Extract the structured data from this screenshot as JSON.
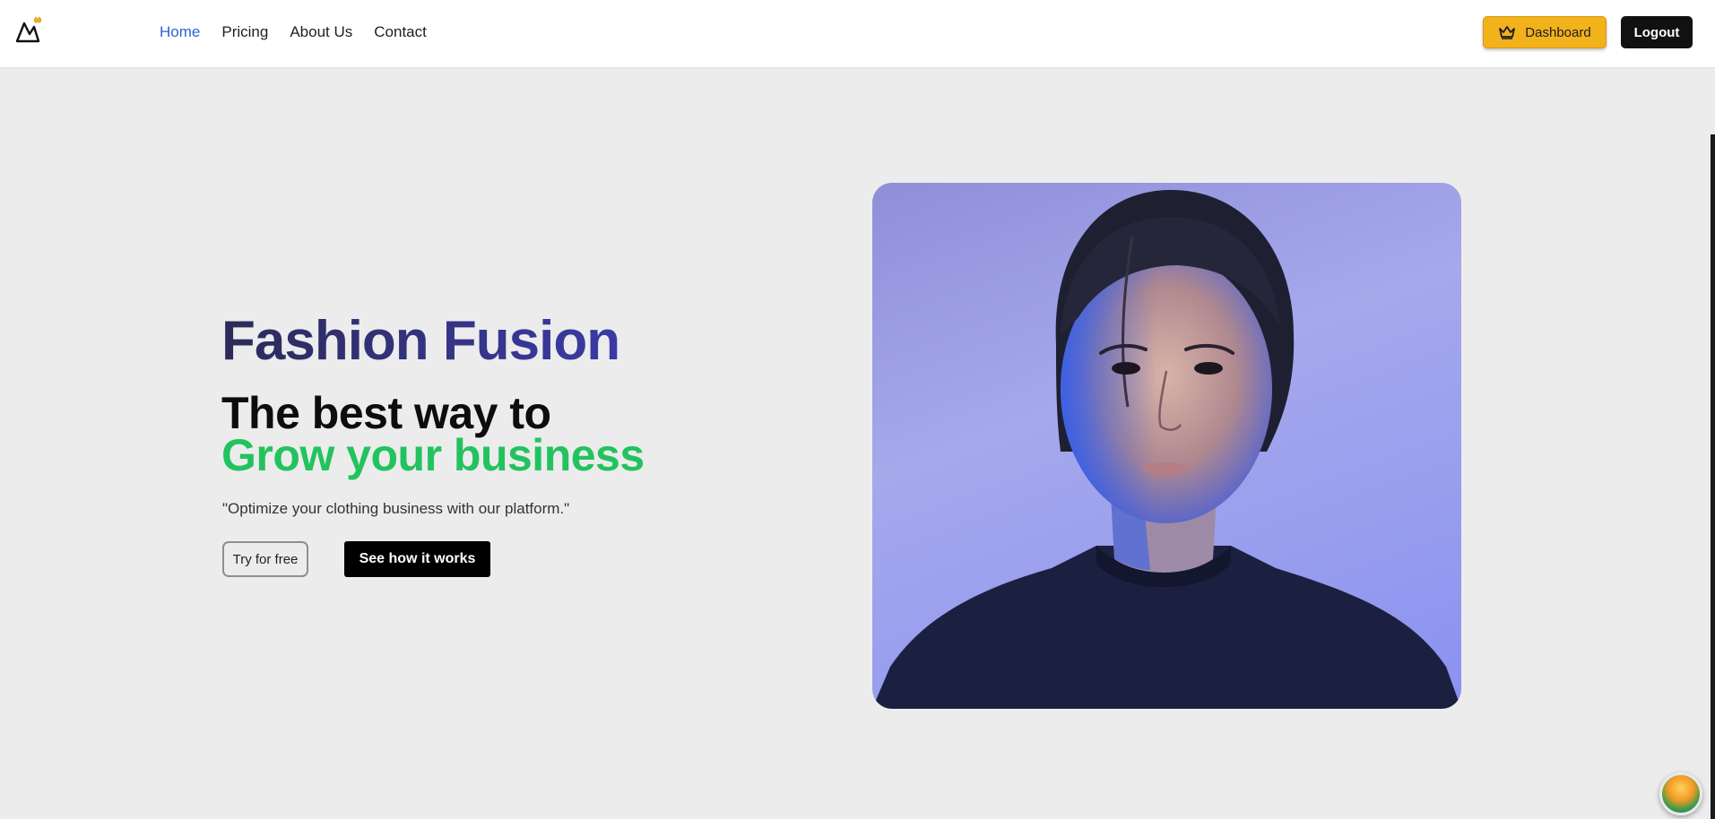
{
  "header": {
    "logo_icon": "mountain-crown-logo",
    "nav": [
      {
        "label": "Home",
        "active": true
      },
      {
        "label": "Pricing",
        "active": false
      },
      {
        "label": "About Us",
        "active": false
      },
      {
        "label": "Contact",
        "active": false
      }
    ],
    "dashboard": {
      "label": "Dashboard",
      "icon": "crown-icon"
    },
    "logout": {
      "label": "Logout"
    }
  },
  "hero": {
    "title": "Fashion Fusion",
    "headline_line1": "The best way to",
    "headline_line2": "Grow your business",
    "subtitle": "\"Optimize your clothing business with our platform.\"",
    "cta_try": "Try for free",
    "cta_see": "See how it works",
    "image": "portrait-photo"
  },
  "colors": {
    "accent_nav": "#2a63d6",
    "dashboard_bg": "#f2b21b",
    "headline_green": "#22c35e",
    "title_gradient": [
      "#2c2b58",
      "#3b3aa6"
    ],
    "page_bg": "#ececec"
  },
  "widget": {
    "icon": "beach-widget-icon"
  }
}
